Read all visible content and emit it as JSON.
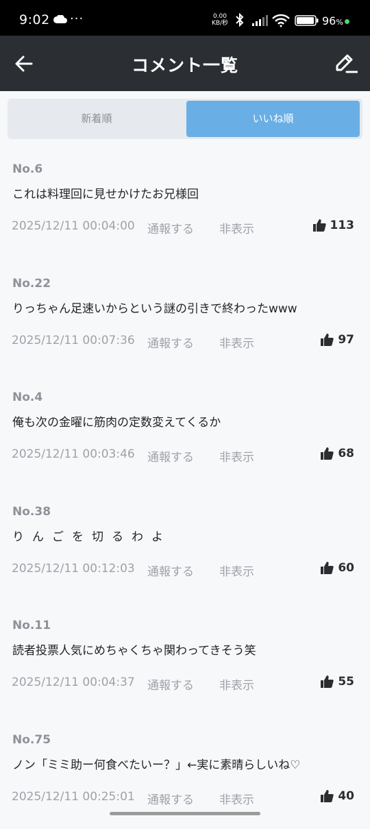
{
  "status_bar": {
    "time": "9:02",
    "dots": "···",
    "net_speed_value": "0.00",
    "net_speed_unit": "KB/秒",
    "battery_percent": "96",
    "percent_sign": "%"
  },
  "app_bar": {
    "title": "コメント一覧",
    "back_icon": "arrow-left-icon",
    "edit_icon": "pencil-icon"
  },
  "tabs": [
    {
      "label": "新着順",
      "active": false
    },
    {
      "label": "いいね順",
      "active": true
    }
  ],
  "actions": {
    "report_label": "通報する",
    "hide_label": "非表示"
  },
  "comments": [
    {
      "no": "No.6",
      "text": "これは料理回に見せかけたお兄様回",
      "date": "2025/12/11 00:04:00",
      "likes": "113"
    },
    {
      "no": "No.22",
      "text": "りっちゃん足速いからという謎の引きで終わったwww",
      "date": "2025/12/11 00:07:36",
      "likes": "97"
    },
    {
      "no": "No.4",
      "text": "俺も次の金曜に筋肉の定数変えてくるか",
      "date": "2025/12/11 00:03:46",
      "likes": "68"
    },
    {
      "no": "No.38",
      "text": "りんごを切るわよ",
      "date": "2025/12/11 00:12:03",
      "likes": "60"
    },
    {
      "no": "No.11",
      "text": "読者投票人気にめちゃくちゃ関わってきそう笑",
      "date": "2025/12/11 00:04:37",
      "likes": "55"
    },
    {
      "no": "No.75",
      "text": "ノン「ミミ助ー何食べたいー？」←実に素晴らしいね♡",
      "date": "2025/12/11 00:25:01",
      "likes": "40"
    }
  ],
  "colors": {
    "app_bar_bg": "#2b2f33",
    "active_tab_bg": "#6aaee6",
    "page_bg": "#f7f8fa"
  }
}
